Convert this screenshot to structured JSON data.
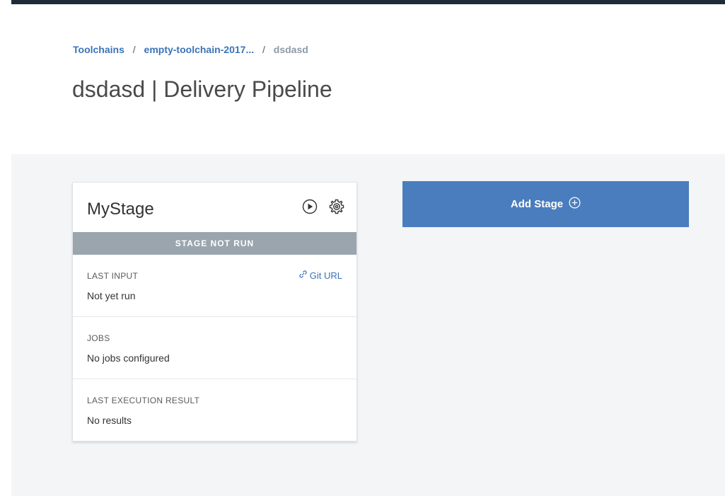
{
  "breadcrumb": {
    "items": [
      "Toolchains",
      "empty-toolchain-2017...",
      "dsdasd"
    ],
    "separator": "/"
  },
  "page": {
    "title": "dsdasd | Delivery Pipeline"
  },
  "stage": {
    "name": "MyStage",
    "status": "STAGE NOT RUN",
    "icons": [
      "play-icon",
      "gear-icon"
    ],
    "sections": [
      {
        "label": "LAST INPUT",
        "value": "Not yet run",
        "link": "Git URL"
      },
      {
        "label": "JOBS",
        "value": "No jobs configured"
      },
      {
        "label": "LAST EXECUTION RESULT",
        "value": "No results"
      }
    ]
  },
  "add_stage": {
    "label": "Add Stage",
    "icon": "plus-circle-icon"
  },
  "colors": {
    "accent": "#4a7dbd",
    "link": "#3b73b9",
    "status_bar": "#9aa5ae",
    "top_bar": "#1f2c38",
    "canvas": "#f4f5f7"
  }
}
